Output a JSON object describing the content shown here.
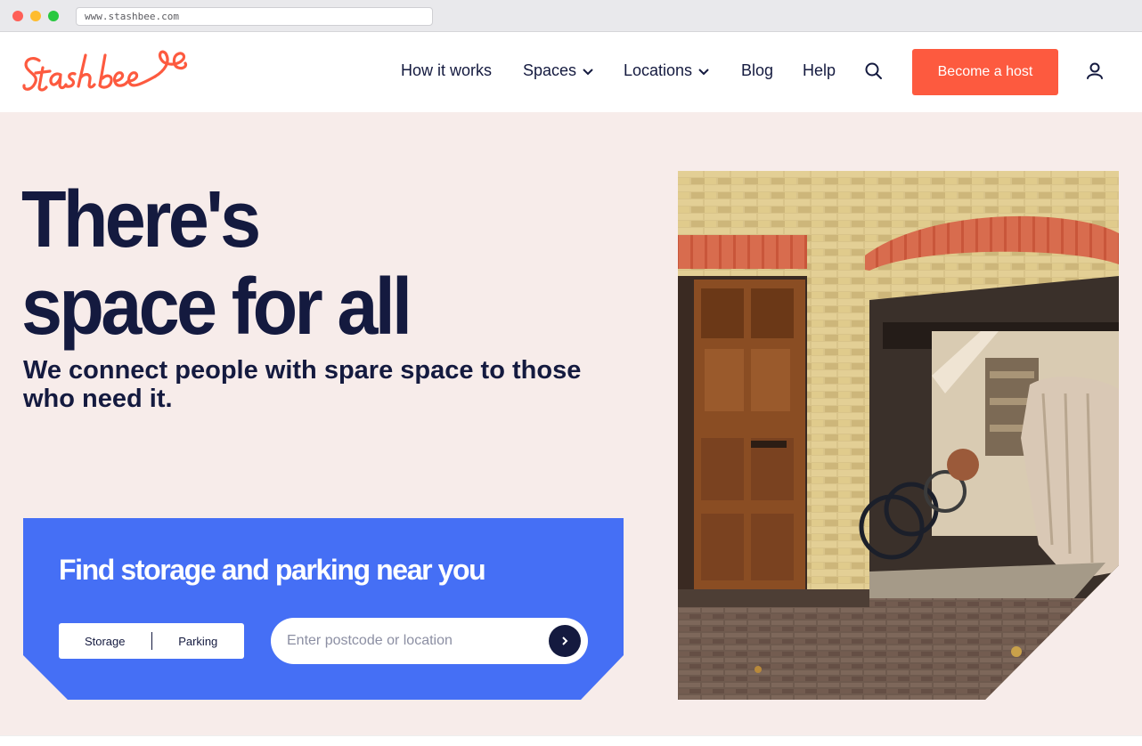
{
  "browser": {
    "url": "www.stashbee.com"
  },
  "brand": {
    "name": "Stashbee",
    "accent": "#fd5a3f",
    "navy": "#141a3f",
    "blue": "#456ff5",
    "hero_bg": "#f7ecea"
  },
  "nav": {
    "items": [
      {
        "label": "How it works",
        "has_dropdown": false
      },
      {
        "label": "Spaces",
        "has_dropdown": true
      },
      {
        "label": "Locations",
        "has_dropdown": true
      },
      {
        "label": "Blog",
        "has_dropdown": false
      },
      {
        "label": "Help",
        "has_dropdown": false
      }
    ],
    "search_icon": "search-icon",
    "cta_label": "Become a host",
    "user_icon": "user-icon"
  },
  "hero": {
    "headline_line1": "There's",
    "headline_line2": "space for all",
    "subheading": "We connect people with spare space to those who need it."
  },
  "finder": {
    "title": "Find storage and parking near you",
    "toggle": [
      "Storage",
      "Parking"
    ],
    "input_value": "",
    "input_placeholder": "Enter postcode or location",
    "submit_icon": "chevron-right-icon"
  }
}
